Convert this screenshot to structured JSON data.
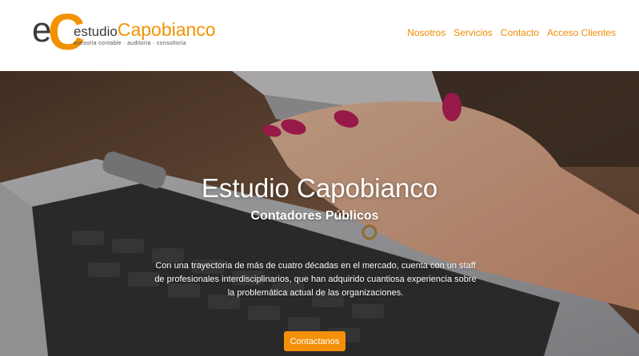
{
  "brand": {
    "logo_e": "e",
    "logo_c": "C",
    "name_prefix": "estudio",
    "name_main": "Capobianco",
    "tagline": "asesoria contable · auditoria · consultoria"
  },
  "nav": {
    "items": [
      "Nosotros",
      "Servicios",
      "Contacto",
      "Acceso Clientes"
    ]
  },
  "hero": {
    "title": "Estudio Capobianco",
    "subtitle": "Contadores Públicos",
    "description": "Con una trayectoria de más de cuatro décadas en el mercado, cuenta con un staff de profesionales interdisciplinarios, que han adquirido cuantiosa experiencia sobre la problemática actual de las organizaciones.",
    "cta_label": "Contactanos"
  },
  "colors": {
    "accent": "#f39200",
    "nav_link": "#f08c00",
    "button": "#f5900a",
    "logo_dark": "#3a3a3a"
  }
}
